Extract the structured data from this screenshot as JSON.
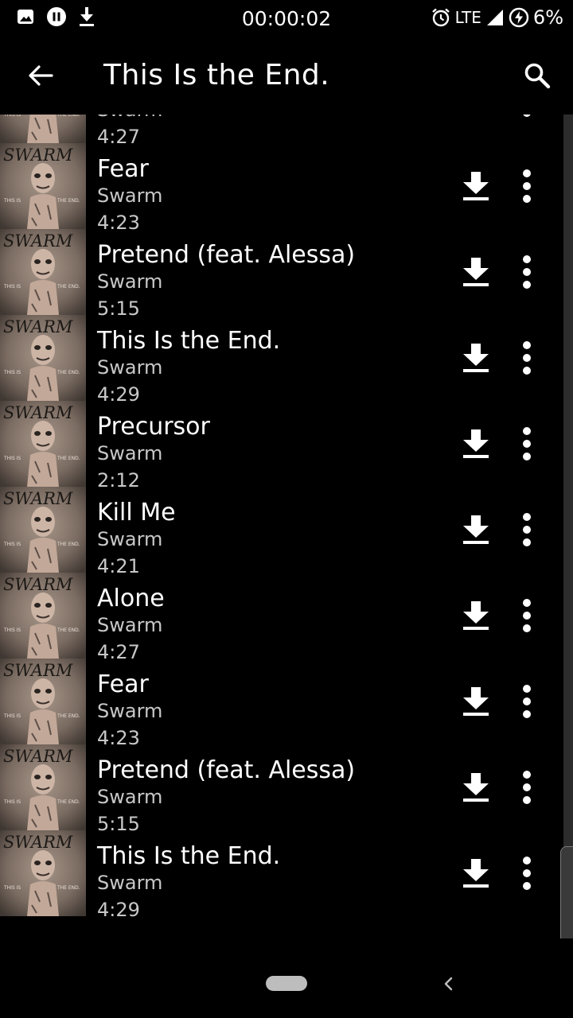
{
  "status_bar": {
    "time": "00:00:02",
    "network": "LTE",
    "battery": "6%"
  },
  "app_bar": {
    "title": "This Is the End."
  },
  "tracks": [
    {
      "title": "",
      "artist": "Swarm",
      "duration": "4:27"
    },
    {
      "title": "Fear",
      "artist": "Swarm",
      "duration": "4:23"
    },
    {
      "title": "Pretend (feat. Alessa)",
      "artist": "Swarm",
      "duration": "5:15"
    },
    {
      "title": "This Is the End.",
      "artist": "Swarm",
      "duration": "4:29"
    },
    {
      "title": "Precursor",
      "artist": "Swarm",
      "duration": "2:12"
    },
    {
      "title": "Kill Me",
      "artist": "Swarm",
      "duration": "4:21"
    },
    {
      "title": "Alone",
      "artist": "Swarm",
      "duration": "4:27"
    },
    {
      "title": "Fear",
      "artist": "Swarm",
      "duration": "4:23"
    },
    {
      "title": "Pretend (feat. Alessa)",
      "artist": "Swarm",
      "duration": "5:15"
    },
    {
      "title": "This Is the End.",
      "artist": "Swarm",
      "duration": "4:29"
    }
  ],
  "album_art": {
    "logo_text": "SWARM",
    "left_text": "THIS IS",
    "right_text": "THE END."
  },
  "icons": {
    "back": "arrow-left-icon",
    "search": "search-icon",
    "download": "download-icon",
    "more": "more-vert-icon"
  },
  "colors": {
    "background": "#000000",
    "text_primary": "#ffffff",
    "text_secondary": "#c8c8c8"
  }
}
